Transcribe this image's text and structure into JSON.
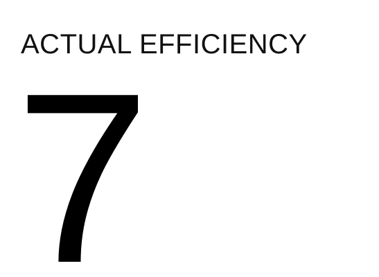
{
  "metric": {
    "label": "ACTUAL EFFICIENCY",
    "value": "7"
  }
}
